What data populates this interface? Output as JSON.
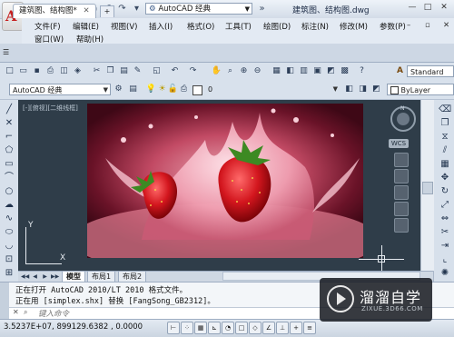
{
  "window": {
    "workspace": "AutoCAD 经典",
    "doc_title": "建筑图、结构图.dwg"
  },
  "menu": {
    "items": [
      "文件(F)",
      "编辑(E)",
      "视图(V)",
      "插入(I)",
      "格式(O)",
      "工具(T)",
      "绘图(D)",
      "标注(N)",
      "修改(M)",
      "参数(P)",
      "窗口(W)",
      "帮助(H)"
    ]
  },
  "tabs": {
    "drawing_tab": "建筑图、结构图*",
    "new_tab": "+"
  },
  "toolbar": {
    "standard_combo": "Standard",
    "workspace_combo": "AutoCAD 经典",
    "layer_combo": "0",
    "bylayer_combo": "ByLayer"
  },
  "viewport": {
    "label": "[-][俯视][二维线框]",
    "wcs": "WCS",
    "compass_n": "N",
    "ucs_x": "X",
    "ucs_y": "Y"
  },
  "layout_tabs": [
    "模型",
    "布局1",
    "布局2"
  ],
  "command": {
    "line1": "正在打开 AutoCAD 2010/LT 2010 格式文件。",
    "line2": "正在用 [simplex.shx] 替换 [FangSong_GB2312]。",
    "prompt": "键入命令"
  },
  "status": {
    "coords": "3.5237E+07, 899129.6382 , 0.0000"
  },
  "watermark": {
    "title": "溜溜自学",
    "url": "ZIXUE.3D66.COM"
  },
  "colors": {
    "accent": "#c62020",
    "drawing_bg": "#2f3d49"
  }
}
